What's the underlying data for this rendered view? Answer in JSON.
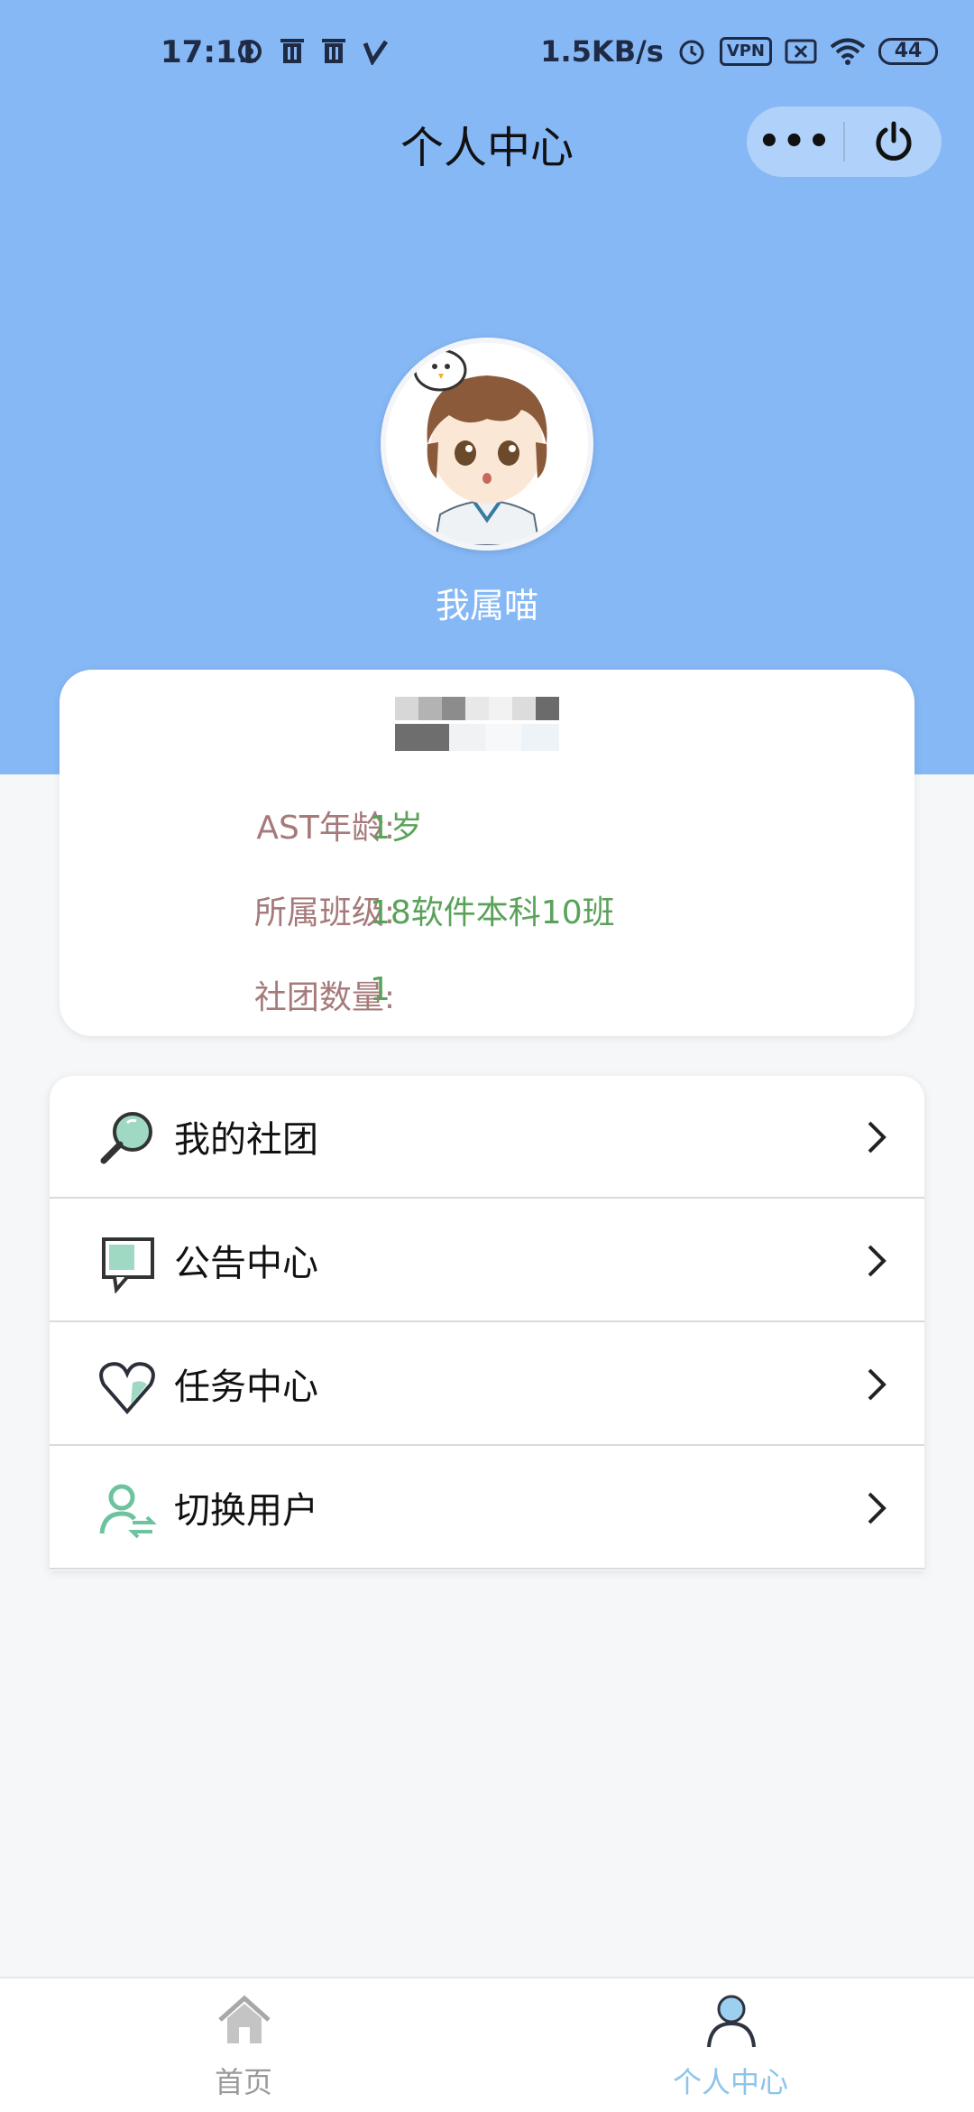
{
  "status_bar": {
    "time": "17:11",
    "network_speed": "1.5KB/s",
    "vpn_badge": "VPN",
    "battery": "44",
    "left_icons": [
      "sync-icon",
      "trash-icon",
      "trash-icon",
      "v-check-icon"
    ],
    "right_icons": [
      "alarm-icon",
      "vpn-icon",
      "sim-off-icon",
      "wifi-icon",
      "battery-icon"
    ]
  },
  "title_bar": {
    "title": "个人中心",
    "more_label": "•••",
    "more_icon": "more-dots-icon",
    "power_icon": "power-icon"
  },
  "profile": {
    "username": "我属喵",
    "avatar_icon": "anime-avatar-image"
  },
  "info_card": {
    "rows": [
      {
        "label": "AST年龄:",
        "value": "1岁"
      },
      {
        "label": "所属班级:",
        "value": "18软件本科10班"
      },
      {
        "label": "社团数量:",
        "value": "1"
      }
    ]
  },
  "menu": {
    "items": [
      {
        "label": "我的社团",
        "icon": "magnifier-icon"
      },
      {
        "label": "公告中心",
        "icon": "message-board-icon"
      },
      {
        "label": "任务中心",
        "icon": "heart-icon"
      },
      {
        "label": "切换用户",
        "icon": "switch-user-icon"
      }
    ],
    "arrow_icon": "chevron-right-icon"
  },
  "tab_bar": {
    "tabs": [
      {
        "label": "首页",
        "icon": "home-icon",
        "active": false
      },
      {
        "label": "个人中心",
        "icon": "user-icon",
        "active": true
      }
    ]
  },
  "colors": {
    "header_bg": "#86b8f6",
    "label_color": "#a67a7a",
    "value_color": "#5aa25a",
    "tab_active": "#8cc4ea",
    "tab_inactive": "#9a9a9a"
  }
}
